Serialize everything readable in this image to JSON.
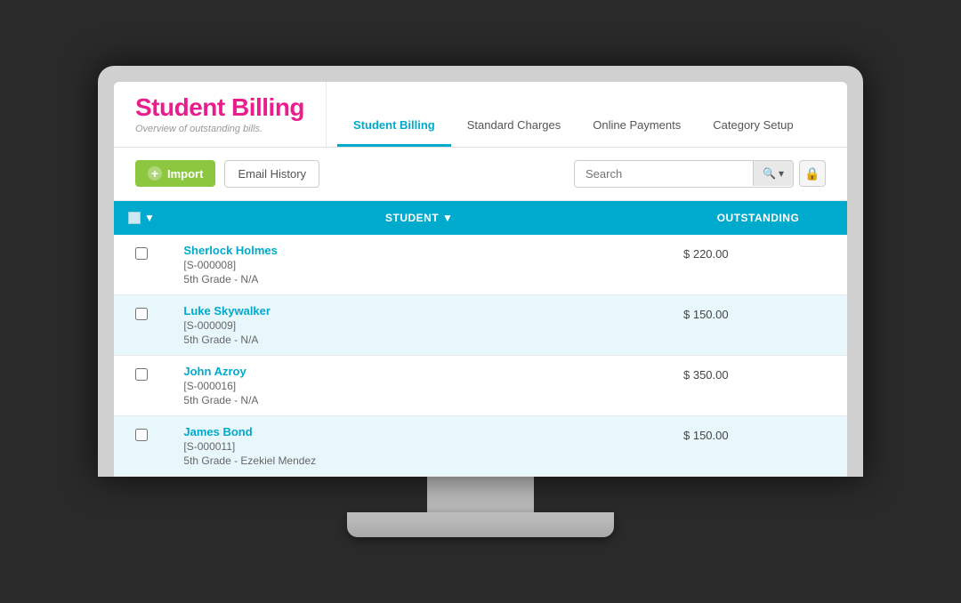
{
  "app": {
    "title": "Student Billing",
    "subtitle": "Overview of outstanding bills."
  },
  "nav": {
    "tabs": [
      {
        "id": "student-billing",
        "label": "Student Billing",
        "active": true
      },
      {
        "id": "standard-charges",
        "label": "Standard Charges",
        "active": false
      },
      {
        "id": "online-payments",
        "label": "Online Payments",
        "active": false
      },
      {
        "id": "category-setup",
        "label": "Category Setup",
        "active": false
      }
    ]
  },
  "toolbar": {
    "import_label": "Import",
    "email_history_label": "Email History",
    "search_placeholder": "Search"
  },
  "table": {
    "headers": {
      "student": "STUDENT",
      "outstanding": "OUTSTANDING"
    },
    "rows": [
      {
        "id": "row-1",
        "name": "Sherlock Holmes",
        "student_id": "[S-000008]",
        "grade": "5th Grade - N/A",
        "outstanding": "$ 220.00"
      },
      {
        "id": "row-2",
        "name": "Luke Skywalker",
        "student_id": "[S-000009]",
        "grade": "5th Grade - N/A",
        "outstanding": "$ 150.00"
      },
      {
        "id": "row-3",
        "name": "John Azroy",
        "student_id": "[S-000016]",
        "grade": "5th Grade - N/A",
        "outstanding": "$ 350.00"
      },
      {
        "id": "row-4",
        "name": "James Bond",
        "student_id": "[S-000011]",
        "grade": "5th Grade - Ezekiel Mendez",
        "outstanding": "$ 150.00"
      }
    ]
  },
  "icons": {
    "plus": "+",
    "search": "🔍",
    "lock": "🔒",
    "sort_down": "▼",
    "dropdown": "▾"
  },
  "colors": {
    "accent_blue": "#00aacc",
    "accent_pink": "#e91e8c",
    "accent_green": "#8dc63f",
    "table_header": "#00aacc",
    "row_even": "#e8f7fb",
    "row_odd": "#ffffff"
  }
}
